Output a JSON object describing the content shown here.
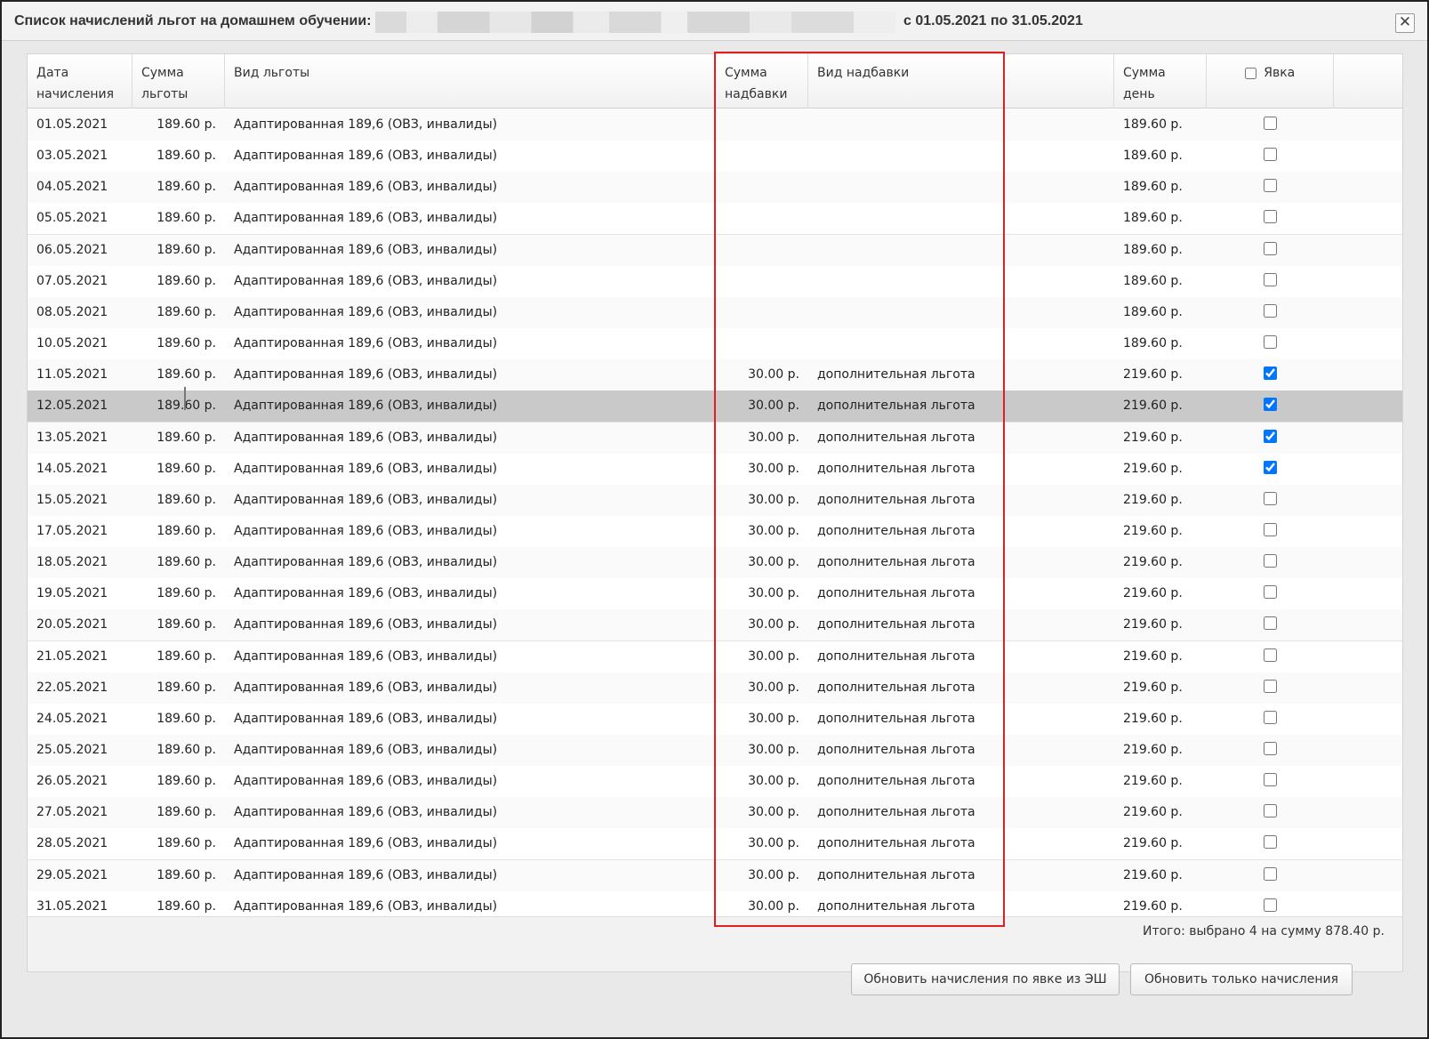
{
  "window": {
    "title": "Список начислений льгот на домашнем обучении:",
    "period": "с 01.05.2021 по 31.05.2021",
    "close_symbol": "✕"
  },
  "columns": {
    "date_line1": "Дата",
    "date_line2": "начисления",
    "sum_line1": "Сумма",
    "sum_line2": "льготы",
    "kind": "Вид льготы",
    "add_sum_line1": "Сумма",
    "add_sum_line2": "надбавки",
    "add_kind": "Вид надбавки",
    "day_sum_line1": "Сумма",
    "day_sum_line2": "день",
    "attendance": "Явка"
  },
  "rows": [
    {
      "date": "01.05.2021",
      "sum": "189.60 р.",
      "kind": "Адаптированная 189,6 (ОВЗ, инвалиды)",
      "add_sum": "",
      "add_kind": "",
      "day_sum": "189.60 р.",
      "checked": false
    },
    {
      "date": "03.05.2021",
      "sum": "189.60 р.",
      "kind": "Адаптированная 189,6 (ОВЗ, инвалиды)",
      "add_sum": "",
      "add_kind": "",
      "day_sum": "189.60 р.",
      "checked": false
    },
    {
      "date": "04.05.2021",
      "sum": "189.60 р.",
      "kind": "Адаптированная 189,6 (ОВЗ, инвалиды)",
      "add_sum": "",
      "add_kind": "",
      "day_sum": "189.60 р.",
      "checked": false
    },
    {
      "date": "05.05.2021",
      "sum": "189.60 р.",
      "kind": "Адаптированная 189,6 (ОВЗ, инвалиды)",
      "add_sum": "",
      "add_kind": "",
      "day_sum": "189.60 р.",
      "checked": false
    },
    {
      "date": "06.05.2021",
      "sum": "189.60 р.",
      "kind": "Адаптированная 189,6 (ОВЗ, инвалиды)",
      "add_sum": "",
      "add_kind": "",
      "day_sum": "189.60 р.",
      "checked": false
    },
    {
      "date": "07.05.2021",
      "sum": "189.60 р.",
      "kind": "Адаптированная 189,6 (ОВЗ, инвалиды)",
      "add_sum": "",
      "add_kind": "",
      "day_sum": "189.60 р.",
      "checked": false
    },
    {
      "date": "08.05.2021",
      "sum": "189.60 р.",
      "kind": "Адаптированная 189,6 (ОВЗ, инвалиды)",
      "add_sum": "",
      "add_kind": "",
      "day_sum": "189.60 р.",
      "checked": false
    },
    {
      "date": "10.05.2021",
      "sum": "189.60 р.",
      "kind": "Адаптированная 189,6 (ОВЗ, инвалиды)",
      "add_sum": "",
      "add_kind": "",
      "day_sum": "189.60 р.",
      "checked": false
    },
    {
      "date": "11.05.2021",
      "sum": "189.60 р.",
      "kind": "Адаптированная 189,6 (ОВЗ, инвалиды)",
      "add_sum": "30.00 р.",
      "add_kind": "дополнительная льгота",
      "day_sum": "219.60 р.",
      "checked": true
    },
    {
      "date": "12.05.2021",
      "sum": "189.60 р.",
      "kind": "Адаптированная 189,6 (ОВЗ, инвалиды)",
      "add_sum": "30.00 р.",
      "add_kind": "дополнительная льгота",
      "day_sum": "219.60 р.",
      "checked": true,
      "selected": true
    },
    {
      "date": "13.05.2021",
      "sum": "189.60 р.",
      "kind": "Адаптированная 189,6 (ОВЗ, инвалиды)",
      "add_sum": "30.00 р.",
      "add_kind": "дополнительная льгота",
      "day_sum": "219.60 р.",
      "checked": true
    },
    {
      "date": "14.05.2021",
      "sum": "189.60 р.",
      "kind": "Адаптированная 189,6 (ОВЗ, инвалиды)",
      "add_sum": "30.00 р.",
      "add_kind": "дополнительная льгота",
      "day_sum": "219.60 р.",
      "checked": true
    },
    {
      "date": "15.05.2021",
      "sum": "189.60 р.",
      "kind": "Адаптированная 189,6 (ОВЗ, инвалиды)",
      "add_sum": "30.00 р.",
      "add_kind": "дополнительная льгота",
      "day_sum": "219.60 р.",
      "checked": false
    },
    {
      "date": "17.05.2021",
      "sum": "189.60 р.",
      "kind": "Адаптированная 189,6 (ОВЗ, инвалиды)",
      "add_sum": "30.00 р.",
      "add_kind": "дополнительная льгота",
      "day_sum": "219.60 р.",
      "checked": false
    },
    {
      "date": "18.05.2021",
      "sum": "189.60 р.",
      "kind": "Адаптированная 189,6 (ОВЗ, инвалиды)",
      "add_sum": "30.00 р.",
      "add_kind": "дополнительная льгота",
      "day_sum": "219.60 р.",
      "checked": false
    },
    {
      "date": "19.05.2021",
      "sum": "189.60 р.",
      "kind": "Адаптированная 189,6 (ОВЗ, инвалиды)",
      "add_sum": "30.00 р.",
      "add_kind": "дополнительная льгота",
      "day_sum": "219.60 р.",
      "checked": false
    },
    {
      "date": "20.05.2021",
      "sum": "189.60 р.",
      "kind": "Адаптированная 189,6 (ОВЗ, инвалиды)",
      "add_sum": "30.00 р.",
      "add_kind": "дополнительная льгота",
      "day_sum": "219.60 р.",
      "checked": false
    },
    {
      "date": "21.05.2021",
      "sum": "189.60 р.",
      "kind": "Адаптированная 189,6 (ОВЗ, инвалиды)",
      "add_sum": "30.00 р.",
      "add_kind": "дополнительная льгота",
      "day_sum": "219.60 р.",
      "checked": false
    },
    {
      "date": "22.05.2021",
      "sum": "189.60 р.",
      "kind": "Адаптированная 189,6 (ОВЗ, инвалиды)",
      "add_sum": "30.00 р.",
      "add_kind": "дополнительная льгота",
      "day_sum": "219.60 р.",
      "checked": false
    },
    {
      "date": "24.05.2021",
      "sum": "189.60 р.",
      "kind": "Адаптированная 189,6 (ОВЗ, инвалиды)",
      "add_sum": "30.00 р.",
      "add_kind": "дополнительная льгота",
      "day_sum": "219.60 р.",
      "checked": false
    },
    {
      "date": "25.05.2021",
      "sum": "189.60 р.",
      "kind": "Адаптированная 189,6 (ОВЗ, инвалиды)",
      "add_sum": "30.00 р.",
      "add_kind": "дополнительная льгота",
      "day_sum": "219.60 р.",
      "checked": false
    },
    {
      "date": "26.05.2021",
      "sum": "189.60 р.",
      "kind": "Адаптированная 189,6 (ОВЗ, инвалиды)",
      "add_sum": "30.00 р.",
      "add_kind": "дополнительная льгота",
      "day_sum": "219.60 р.",
      "checked": false
    },
    {
      "date": "27.05.2021",
      "sum": "189.60 р.",
      "kind": "Адаптированная 189,6 (ОВЗ, инвалиды)",
      "add_sum": "30.00 р.",
      "add_kind": "дополнительная льгота",
      "day_sum": "219.60 р.",
      "checked": false
    },
    {
      "date": "28.05.2021",
      "sum": "189.60 р.",
      "kind": "Адаптированная 189,6 (ОВЗ, инвалиды)",
      "add_sum": "30.00 р.",
      "add_kind": "дополнительная льгота",
      "day_sum": "219.60 р.",
      "checked": false
    },
    {
      "date": "29.05.2021",
      "sum": "189.60 р.",
      "kind": "Адаптированная 189,6 (ОВЗ, инвалиды)",
      "add_sum": "30.00 р.",
      "add_kind": "дополнительная льгота",
      "day_sum": "219.60 р.",
      "checked": false
    },
    {
      "date": "31.05.2021",
      "sum": "189.60 р.",
      "kind": "Адаптированная 189,6 (ОВЗ, инвалиды)",
      "add_sum": "30.00 р.",
      "add_kind": "дополнительная льгота",
      "day_sum": "219.60 р.",
      "checked": false
    }
  ],
  "summary": "Итого: выбрано 4 на сумму 878.40 р.",
  "buttons": {
    "refresh_by_attendance": "Обновить начисления по явке из ЭШ",
    "refresh_only": "Обновить только начисления"
  },
  "colors": {
    "highlight_border": "#e02020",
    "selected_row": "#c9c9c9"
  }
}
